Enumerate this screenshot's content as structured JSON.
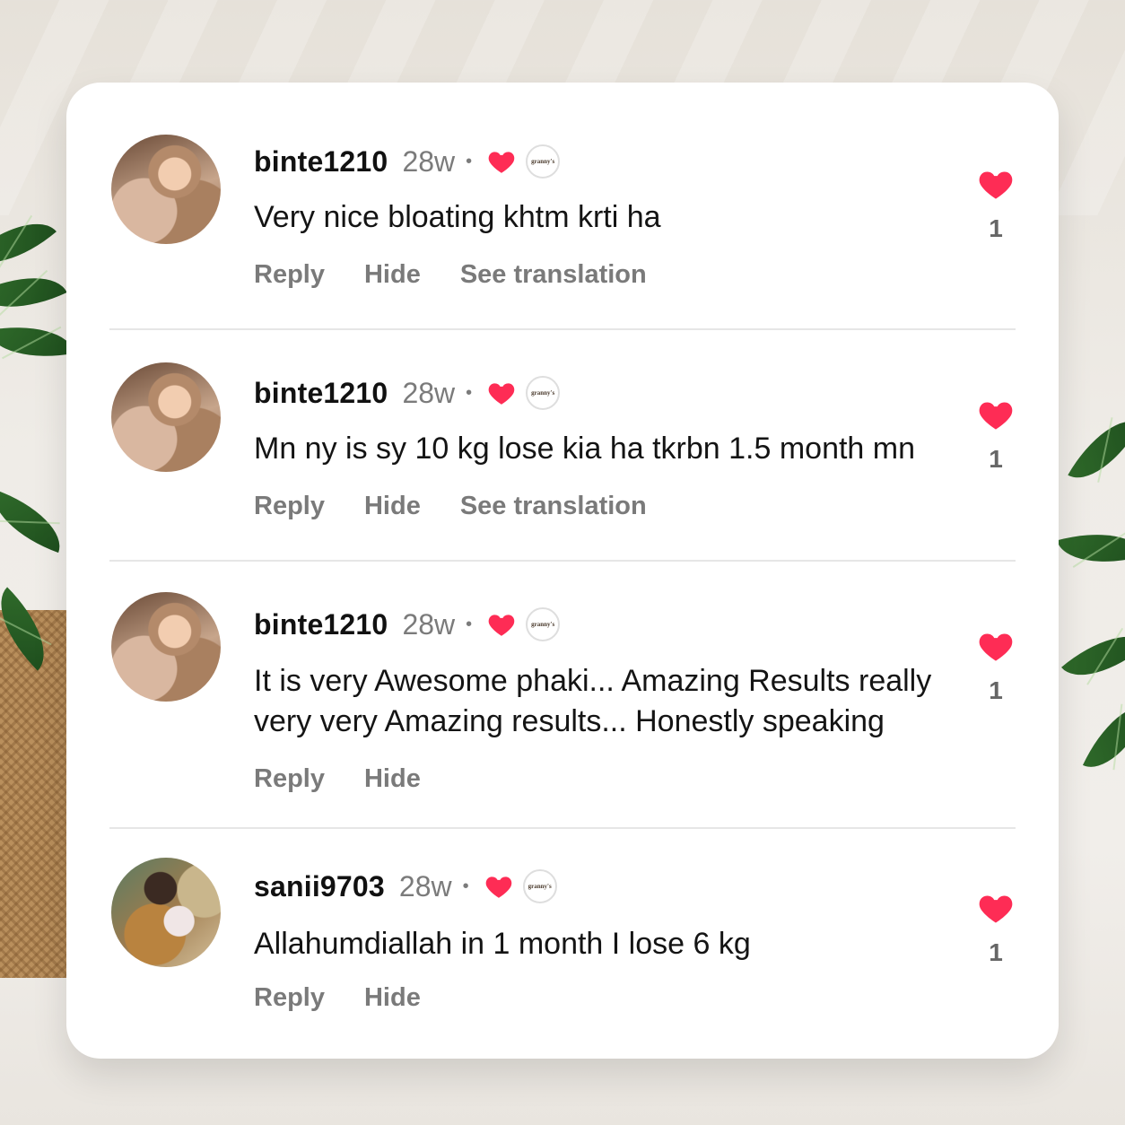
{
  "comments": [
    {
      "avatar": "baby-photo",
      "username": "binte1210",
      "time": "28w",
      "separator": "•",
      "badge": "granny's",
      "text": "Very nice bloating khtm krti ha",
      "actions": [
        "Reply",
        "Hide",
        "See translation"
      ],
      "likes": "1"
    },
    {
      "avatar": "baby-photo",
      "username": "binte1210",
      "time": "28w",
      "separator": "•",
      "badge": "granny's",
      "text": "Mn ny is sy 10 kg lose kia ha tkrbn 1.5 month mn",
      "actions": [
        "Reply",
        "Hide",
        "See translation"
      ],
      "likes": "1"
    },
    {
      "avatar": "baby-photo",
      "username": "binte1210",
      "time": "28w",
      "separator": "•",
      "badge": "granny's",
      "text": "It is very Awesome phaki... Amazing Results really very very Amazing results... Honestly speaking",
      "actions": [
        "Reply",
        "Hide"
      ],
      "likes": "1"
    },
    {
      "avatar": "mother-photo",
      "username": "sanii9703",
      "time": "28w",
      "separator": "•",
      "badge": "granny's",
      "text": "Allahumdiallah in 1 month I lose 6 kg",
      "actions": [
        "Reply",
        "Hide"
      ],
      "likes": "1"
    }
  ],
  "colors": {
    "heart": "#fe2c55",
    "action": "#7a7a7a"
  },
  "icons": {
    "like": "heart-icon",
    "creator_liked": "heart-icon",
    "creator_badge": "granny's logo"
  }
}
